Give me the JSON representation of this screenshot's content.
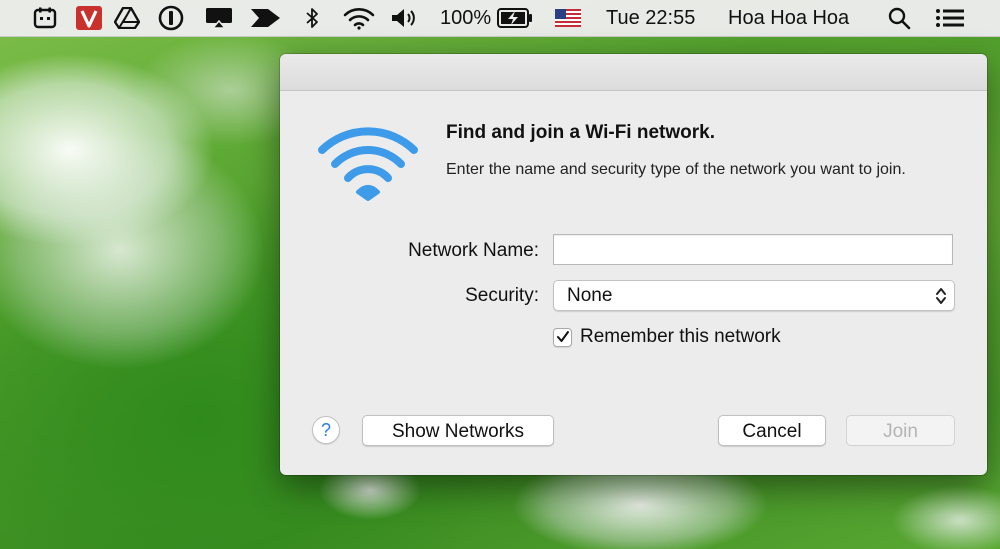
{
  "menubar": {
    "icons": [
      "calendar-icon",
      "vivaldi-icon",
      "google-drive-icon",
      "onepassword-icon",
      "airplay-icon",
      "arrow-icon",
      "bluetooth-icon",
      "wifi-icon",
      "volume-icon",
      "battery-icon",
      "us-flag-icon",
      "search-icon",
      "list-icon"
    ],
    "battery_percent": "100%",
    "clock": "Tue 22:55",
    "user_name": "Hoa Hoa Hoa"
  },
  "dialog": {
    "heading": "Find and join a Wi-Fi network.",
    "description": "Enter the name and security type of the network you want to join.",
    "network_name_label": "Network Name:",
    "network_name_value": "",
    "security_label": "Security:",
    "security_value": "None",
    "remember_label": "Remember this network",
    "remember_checked": true,
    "help_label": "?",
    "show_networks_label": "Show Networks",
    "cancel_label": "Cancel",
    "join_label": "Join",
    "join_enabled": false
  },
  "colors": {
    "wifi_blue": "#3d9be9",
    "help_blue": "#2a7ee6",
    "dialog_bg": "#ececec"
  }
}
